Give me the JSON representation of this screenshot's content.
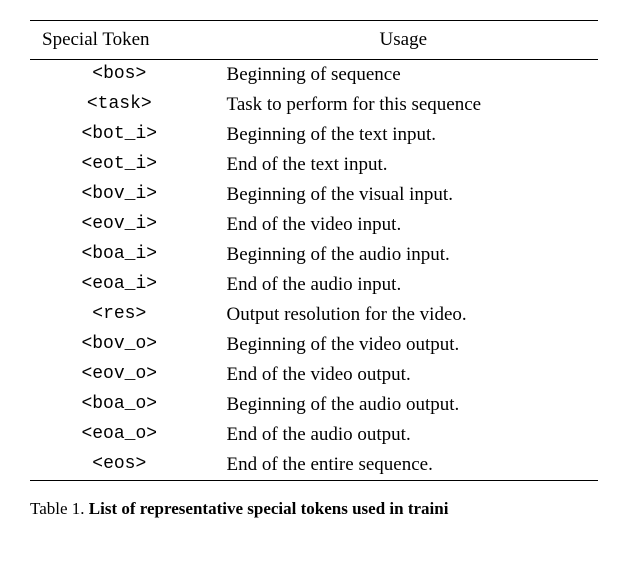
{
  "chart_data": {
    "type": "table",
    "headers": [
      "Special Token",
      "Usage"
    ],
    "rows": [
      {
        "token": "<bos>",
        "usage": "Beginning of sequence"
      },
      {
        "token": "<task>",
        "usage": "Task to perform for this sequence"
      },
      {
        "token": "<bot_i>",
        "usage": "Beginning of the text input."
      },
      {
        "token": "<eot_i>",
        "usage": "End of the text input."
      },
      {
        "token": "<bov_i>",
        "usage": "Beginning of the visual input."
      },
      {
        "token": "<eov_i>",
        "usage": "End of the video input."
      },
      {
        "token": "<boa_i>",
        "usage": "Beginning of the audio input."
      },
      {
        "token": "<eoa_i>",
        "usage": "End of the audio input."
      },
      {
        "token": "<res>",
        "usage": "Output resolution for the video."
      },
      {
        "token": "<bov_o>",
        "usage": "Beginning of the video output."
      },
      {
        "token": "<eov_o>",
        "usage": "End of the video output."
      },
      {
        "token": "<boa_o>",
        "usage": "Beginning of the audio output."
      },
      {
        "token": "<eoa_o>",
        "usage": "End of the audio output."
      },
      {
        "token": "<eos>",
        "usage": "End of the entire sequence."
      }
    ]
  },
  "caption_prefix": "Table 1. ",
  "caption_text": "List of representative special tokens used in traini"
}
